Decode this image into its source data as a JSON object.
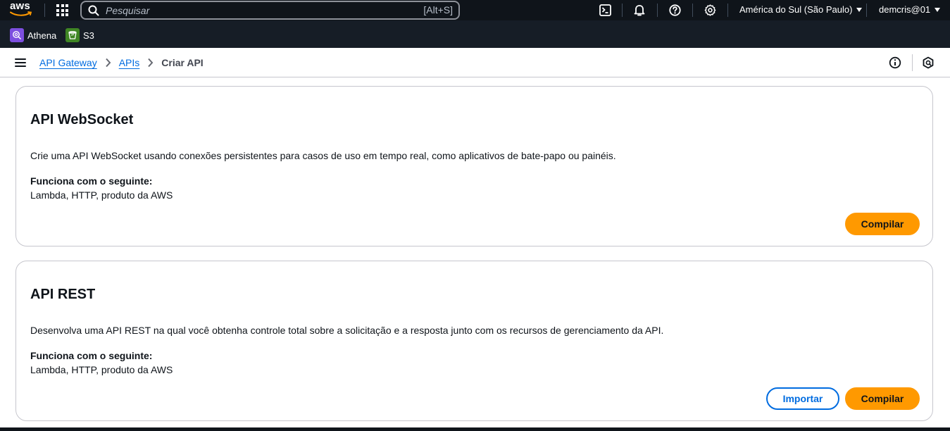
{
  "topnav": {
    "logo_text": "aws",
    "search": {
      "placeholder": "Pesquisar",
      "shortcut": "[Alt+S]"
    },
    "icons": [
      "cloudshell-icon",
      "bell-icon",
      "help-icon",
      "settings-icon"
    ],
    "region": "América do Sul (São Paulo)",
    "user": "demcris@01"
  },
  "favorites": [
    {
      "label": "Athena",
      "icon": "athena-icon",
      "color": "#7d4fe0"
    },
    {
      "label": "S3",
      "icon": "s3-icon",
      "color": "#3f8624"
    }
  ],
  "breadcrumb": {
    "items": [
      "API Gateway",
      "APIs"
    ],
    "current": "Criar API"
  },
  "cards": [
    {
      "title": "API WebSocket",
      "description": "Crie uma API WebSocket usando conexões persistentes para casos de uso em tempo real, como aplicativos de bate-papo ou painéis.",
      "works_with_label": "Funciona com o seguinte:",
      "works_with": "Lambda, HTTP, produto da AWS",
      "build_label": "Compilar"
    },
    {
      "title": "API REST",
      "description": "Desenvolva uma API REST na qual você obtenha controle total sobre a solicitação e a resposta junto com os recursos de gerenciamento da API.",
      "works_with_label": "Funciona com o seguinte:",
      "works_with": "Lambda, HTTP, produto da AWS",
      "import_label": "Importar",
      "build_label": "Compilar"
    }
  ],
  "colors": {
    "nav_bg": "#0f141a",
    "favbar_bg": "#161d26",
    "primary": "#ff9900",
    "link": "#006ce0"
  }
}
